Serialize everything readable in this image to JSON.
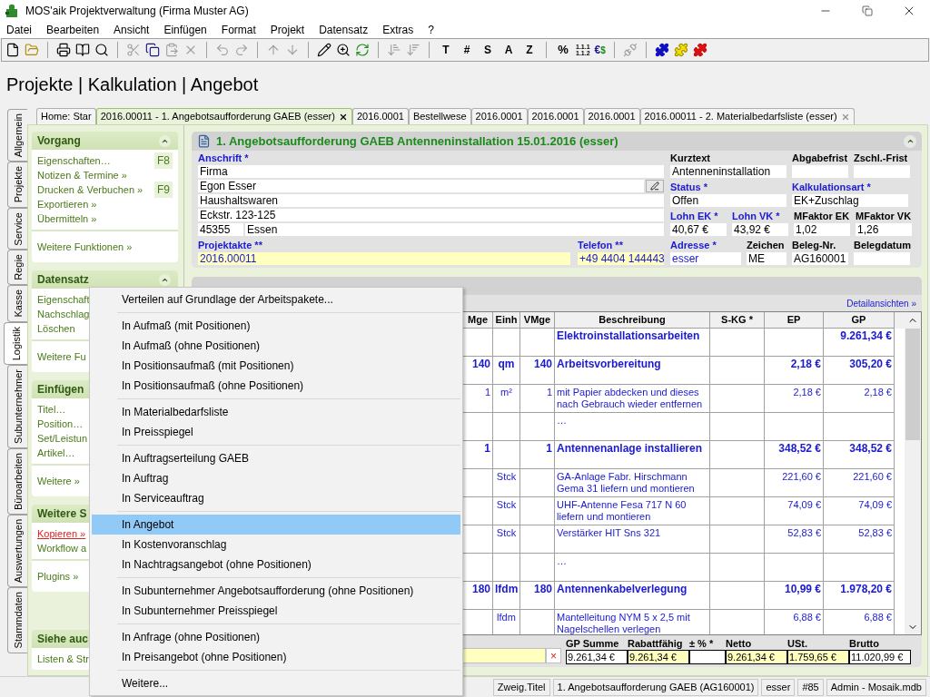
{
  "window": {
    "title": "MOS'aik Projektverwaltung (Firma Muster AG)"
  },
  "menu_bar": [
    "Datei",
    "Bearbeiten",
    "Ansicht",
    "Einfügen",
    "Format",
    "Projekt",
    "Datensatz",
    "Extras",
    "?"
  ],
  "toolbar": {
    "format_buttons": [
      "T",
      "#",
      "S",
      "A",
      "Z"
    ],
    "percent_button": "%",
    "numbering_button": [
      "1.1.1",
      "1.1.2"
    ],
    "currency_button": [
      "€",
      "$"
    ]
  },
  "breadcrumb": "Projekte | Kalkulation | Angebot",
  "side_tabs": [
    {
      "label": "Allgemein",
      "selected": false
    },
    {
      "label": "Projekte",
      "selected": false
    },
    {
      "label": "Service",
      "selected": false
    },
    {
      "label": "Regie",
      "selected": false
    },
    {
      "label": "Kasse",
      "selected": false
    },
    {
      "label": "Logistik",
      "selected": true
    },
    {
      "label": "Subunternehmer",
      "selected": false
    },
    {
      "label": "Büroarbeiten",
      "selected": false
    },
    {
      "label": "Auswertungen",
      "selected": false
    },
    {
      "label": "Stammdaten",
      "selected": false
    }
  ],
  "doc_tabs": [
    {
      "label": "Home: Star",
      "selected": false,
      "closable": false
    },
    {
      "label": "2016.00011 - 1. Angebotsaufforderung GAEB (esser)",
      "selected": true,
      "closable": true
    },
    {
      "label": "2016.0001",
      "selected": false,
      "closable": false
    },
    {
      "label": "Bestellwese",
      "selected": false,
      "closable": false
    },
    {
      "label": "2016.0001",
      "selected": false,
      "closable": false
    },
    {
      "label": "2016.0001",
      "selected": false,
      "closable": false
    },
    {
      "label": "2016.0001",
      "selected": false,
      "closable": false
    },
    {
      "label": "2016.00011 - 2. Materialbedarfsliste (esser)",
      "selected": false,
      "closable": true
    }
  ],
  "sidebar": [
    {
      "title": "Vorgang",
      "collapse_button": true,
      "groups": [
        [
          {
            "label": "Eigenschaften…",
            "shortcut": "F8",
            "active": false
          },
          {
            "label": "Notizen & Termine »",
            "active": false
          },
          {
            "label": "Drucken & Verbuchen »",
            "shortcut": "F9",
            "active": false
          },
          {
            "label": "Exportieren »",
            "active": false
          },
          {
            "label": "Übermitteln »",
            "active": false
          }
        ],
        [
          {
            "label": "Weitere Funktionen »",
            "active": false
          }
        ]
      ]
    },
    {
      "title": "Datensatz",
      "collapse_button": true,
      "groups": [
        [
          {
            "label": "Eigenschaft",
            "active": false
          },
          {
            "label": "Nachschlag",
            "active": false
          },
          {
            "label": "Löschen",
            "active": false
          }
        ],
        [
          {
            "label": "Weitere Fu",
            "active": false
          }
        ]
      ]
    },
    {
      "title": "Einfügen",
      "groups": [
        [
          {
            "label": "Titel…",
            "active": false
          },
          {
            "label": "Position…",
            "active": false
          },
          {
            "label": "Set/Leistun",
            "active": false
          },
          {
            "label": "Artikel…",
            "active": false
          }
        ],
        [
          {
            "label": "Weitere »",
            "active": false
          }
        ]
      ]
    },
    {
      "title": "Weitere S",
      "groups": [
        [
          {
            "label": "Kopieren »",
            "active": true
          },
          {
            "label": "Workflow a",
            "active": false
          }
        ],
        [
          {
            "label": "Plugins »",
            "active": false
          }
        ]
      ]
    },
    {
      "title": "Siehe auc",
      "groups": [
        [
          {
            "label": "Listen & Str",
            "active": false
          }
        ]
      ]
    }
  ],
  "record": {
    "title": "1. Angebotsaufforderung GAEB Antenneninstallation 15.01.2016 (esser)",
    "address": {
      "label": "Anschrift",
      "marker": "*",
      "lines": [
        "Firma",
        "Egon Esser",
        "Haushaltswaren",
        "Eckstr. 123-125"
      ],
      "zip": "45355",
      "city": "Essen"
    },
    "fields": [
      {
        "label": "Projektakte",
        "marker": "**",
        "value": "2016.00011",
        "link": true,
        "highlighted": true
      },
      {
        "label": "Telefon",
        "marker": "**",
        "value": "+49 4404 144443",
        "link": true,
        "highlighted": true
      },
      {
        "label": "Kurztext",
        "value": "Antenneninstallation",
        "link": false,
        "highlighted": false
      },
      {
        "label": "Abgabefrist",
        "highlighted": false
      },
      {
        "label": "Zschl.-Frist",
        "highlighted": false
      },
      {
        "label": "Status",
        "marker": "*",
        "value": "Offen",
        "link": false,
        "highlighted": false
      },
      {
        "label": "Kalkulationsart",
        "marker": "*",
        "value": "EK+Zuschlag",
        "link": false,
        "highlighted": false
      },
      {
        "label": "Lohn EK",
        "marker": "*",
        "value": "40,67 €",
        "link": false,
        "highlighted": false
      },
      {
        "label": "Lohn VK",
        "marker": "*",
        "value": "43,92 €",
        "link": false,
        "highlighted": false
      },
      {
        "label": "MFaktor EK",
        "value": "1,02",
        "link": false,
        "highlighted": false
      },
      {
        "label": "MFaktor VK",
        "value": "1,26",
        "link": false,
        "highlighted": false
      },
      {
        "label": "Adresse",
        "marker": "*",
        "value": "esser",
        "link": true,
        "highlighted": false
      },
      {
        "label": "Zeichen",
        "value": "ME",
        "link": false,
        "highlighted": false
      },
      {
        "label": "Beleg-Nr.",
        "value": "AG160001",
        "link": false,
        "highlighted": false
      },
      {
        "label": "Belegdatum",
        "highlighted": false
      }
    ]
  },
  "positions": {
    "link": "Detailansichten »",
    "columns": [
      "Mge",
      "Einh",
      "VMge",
      "Beschreibung",
      "S-KG *",
      "EP",
      "GP"
    ],
    "rows": [
      {
        "kind": "title",
        "description": "Elektroinstallationsarbeiten",
        "gp": "9.261,34 €"
      },
      {
        "kind": "position",
        "mge": "140",
        "einh": "qm",
        "vmge": "140",
        "description": "Arbeitsvorbereitung",
        "ep": "2,18 €",
        "gp": "305,20 €"
      },
      {
        "kind": "item",
        "mge": "1",
        "einh": "m²",
        "vmge": "1",
        "description": "mit Papier abdecken und dieses nach Gebrauch wieder entfernen",
        "ep": "2,18 €",
        "gp": "2,18 €"
      },
      {
        "kind": "item",
        "description": "…"
      },
      {
        "kind": "position",
        "mge": "1",
        "vmge": "1",
        "description": "Antennenanlage installieren",
        "ep": "348,52 €",
        "gp": "348,52 €"
      },
      {
        "kind": "item",
        "einh": "Stck",
        "description": "GA-Anlage Fabr. Hirschmann Gema 31 liefern und montieren",
        "ep": "221,60 €",
        "gp": "221,60 €"
      },
      {
        "kind": "item",
        "einh": "Stck",
        "description": "UHF-Antenne Fesa 717 N 60 liefern und montieren",
        "ep": "74,09 €",
        "gp": "74,09 €"
      },
      {
        "kind": "item",
        "einh": "Stck",
        "description": "Verstärker HIT Sns 321",
        "ep": "52,83 €",
        "gp": "52,83 €"
      },
      {
        "kind": "item",
        "description": "…"
      },
      {
        "kind": "position",
        "mge": "180",
        "einh": "lfdm",
        "vmge": "180",
        "description": "Antennenkabelverlegung",
        "ep": "10,99 €",
        "gp": "1.978,20 €"
      },
      {
        "kind": "item",
        "einh": "lfdm",
        "description": "Mantelleitung NYM 5 x 2,5 mit Nagelschellen verlegen",
        "ep": "6,88 €",
        "gp": "6,88 €"
      }
    ],
    "clear_button": "×",
    "summary": [
      {
        "label": "GP Summe",
        "value": "9.261,34 €",
        "highlighted": false
      },
      {
        "label": "Rabattfähig",
        "value": "9.261,34 €",
        "highlighted": true
      },
      {
        "label": "± % *",
        "highlighted": false
      },
      {
        "label": "Netto",
        "value": "9.261,34 €",
        "highlighted": true
      },
      {
        "label": "USt.",
        "value": "1.759,65 €",
        "highlighted": true
      },
      {
        "label": "Brutto",
        "value": "11.020,99 €",
        "highlighted": false
      }
    ]
  },
  "status_bar": [
    "Zweig.Titel",
    "1. Angebotsaufforderung GAEB (AG160001)",
    "esser",
    "#85",
    "Admin - Mosaik.mdb"
  ],
  "context_menu": {
    "groups": [
      [
        {
          "label": "Verteilen auf Grundlage der Arbeitspakete...",
          "selected": false
        }
      ],
      [
        {
          "label": "In Aufmaß (mit Positionen)",
          "selected": false
        },
        {
          "label": "In Aufmaß (ohne Positionen)",
          "selected": false
        },
        {
          "label": "In Positionsaufmaß (mit Positionen)",
          "selected": false
        },
        {
          "label": "In Positionsaufmaß (ohne Positionen)",
          "selected": false
        }
      ],
      [
        {
          "label": "In Materialbedarfsliste",
          "selected": false
        },
        {
          "label": "In Preisspiegel",
          "selected": false
        }
      ],
      [
        {
          "label": "In Auftragserteilung GAEB",
          "selected": false
        },
        {
          "label": "In Auftrag",
          "selected": false
        },
        {
          "label": "In Serviceauftrag",
          "selected": false
        }
      ],
      [
        {
          "label": "In Angebot",
          "selected": true
        },
        {
          "label": "In Kostenvoranschlag",
          "selected": false
        },
        {
          "label": "In Nachtragsangebot (ohne Positionen)",
          "selected": false
        }
      ],
      [
        {
          "label": "In Subunternehmer Angebotsaufforderung (ohne Positionen)",
          "selected": false
        },
        {
          "label": "In Subunternehmer Preisspiegel",
          "selected": false
        }
      ],
      [
        {
          "label": "In Anfrage (ohne Positionen)",
          "selected": false
        },
        {
          "label": "In Preisangebot (ohne Positionen)",
          "selected": false
        }
      ],
      [
        {
          "label": "Weitere...",
          "selected": false
        }
      ]
    ]
  }
}
